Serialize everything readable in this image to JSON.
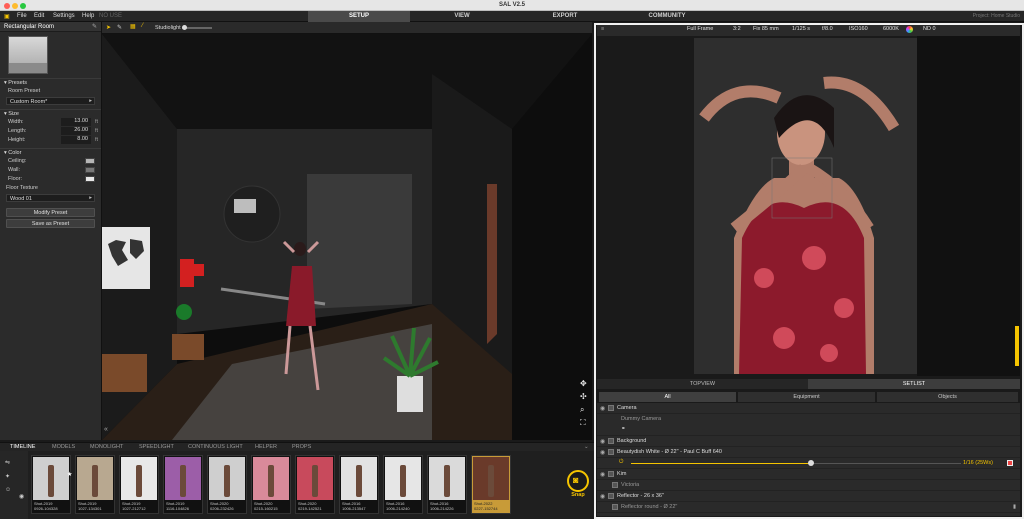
{
  "window": {
    "title": "SAL V2.5"
  },
  "menu": [
    "File",
    "Edit",
    "Settings",
    "Help"
  ],
  "menu_dim": "NO USE",
  "top_tabs": [
    {
      "label": "SETUP",
      "active": true
    },
    {
      "label": "VIEW",
      "active": false
    },
    {
      "label": "EXPORT",
      "active": false
    },
    {
      "label": "COMMUNITY",
      "active": false
    }
  ],
  "project": "Project: Home Studio",
  "left_panel": {
    "title": "Rectangular Room",
    "presets_label": "Presets",
    "room_preset_label": "Room Preset",
    "room_preset_value": "Custom Room*",
    "size_label": "Size",
    "size_rows": [
      {
        "label": "Width:",
        "value": "13.00",
        "unit": "ft"
      },
      {
        "label": "Length:",
        "value": "26.00",
        "unit": "ft"
      },
      {
        "label": "Height:",
        "value": "8.00",
        "unit": "ft"
      }
    ],
    "color_label": "Color",
    "color_rows": [
      {
        "label": "Ceiling:",
        "color": "#b5b5b5"
      },
      {
        "label": "Wall:",
        "color": "#777777"
      },
      {
        "label": "Floor:",
        "color": "#e8e8e8"
      }
    ],
    "floor_texture_label": "Floor Texture",
    "floor_texture_value": "Wood 01",
    "modify_preset": "Modify Preset",
    "save_as_preset": "Save as Preset"
  },
  "viewport_toolbar": {
    "studiolight_label": "Studiolight"
  },
  "preview_toolbar": [
    "Full Frame",
    "3:2",
    "Fix 85 mm",
    "1/125 s",
    "f/8.0",
    "ISO160",
    "6000K",
    "ND 0"
  ],
  "right_tabs": [
    {
      "label": "TOPVIEW",
      "active": false
    },
    {
      "label": "SETLIST",
      "active": true
    }
  ],
  "filters": [
    "All",
    "Equipment",
    "Objects"
  ],
  "setlist": [
    {
      "label": "Camera",
      "child": false
    },
    {
      "label": "Dummy Camera",
      "child": true
    },
    {
      "label": "Background",
      "child": false
    },
    {
      "label": "Beautydish White - Ø 22\" - Paul C Buff 640",
      "child": false
    },
    {
      "label": "Kim",
      "child": false
    },
    {
      "label": "Victoria",
      "child": true
    },
    {
      "label": "Reflector - 26 x 36\"",
      "child": false
    },
    {
      "label": "Reflector round - Ø 22\"",
      "child": true
    }
  ],
  "light_power": "1/16 (25Ws)",
  "timeline_tabs": [
    {
      "label": "TIMELINE",
      "active": true
    },
    {
      "label": "MODELS",
      "active": false
    },
    {
      "label": "MONOLIGHT",
      "active": false
    },
    {
      "label": "SPEEDLIGHT",
      "active": false
    },
    {
      "label": "CONTINUOUS LIGHT",
      "active": false
    },
    {
      "label": "HELPER",
      "active": false
    },
    {
      "label": "PROPS",
      "active": false
    }
  ],
  "shots": [
    {
      "name": "Shot-2019",
      "time": "0926-104328",
      "bg": "#cfcfcf"
    },
    {
      "name": "Shot-2019",
      "time": "1027-134301",
      "bg": "#b8a890"
    },
    {
      "name": "Shot-2019",
      "time": "1027-212712",
      "bg": "#e8e8e8"
    },
    {
      "name": "Shot-2019",
      "time": "1116-104826",
      "bg": "#9c5ea8"
    },
    {
      "name": "Shot-2020",
      "time": "0206-232426",
      "bg": "#cfcfcf"
    },
    {
      "name": "Shot-2020",
      "time": "0215-160215",
      "bg": "#d98a9a"
    },
    {
      "name": "Shot-2020",
      "time": "0219-142521",
      "bg": "#c84a5c"
    },
    {
      "name": "Shot-2016",
      "time": "1006-213547",
      "bg": "#e2e2e2"
    },
    {
      "name": "Shot-2016",
      "time": "1006-214240",
      "bg": "#e6e6e6"
    },
    {
      "name": "Shot-2016",
      "time": "1006-214226",
      "bg": "#dadada"
    },
    {
      "name": "Shot-2022",
      "time": "0227-152744",
      "bg": "#6a3a2a"
    }
  ],
  "snap_label": "Snap",
  "colors": {
    "accent": "#f5c400",
    "selected_shot": "#c89b38"
  }
}
